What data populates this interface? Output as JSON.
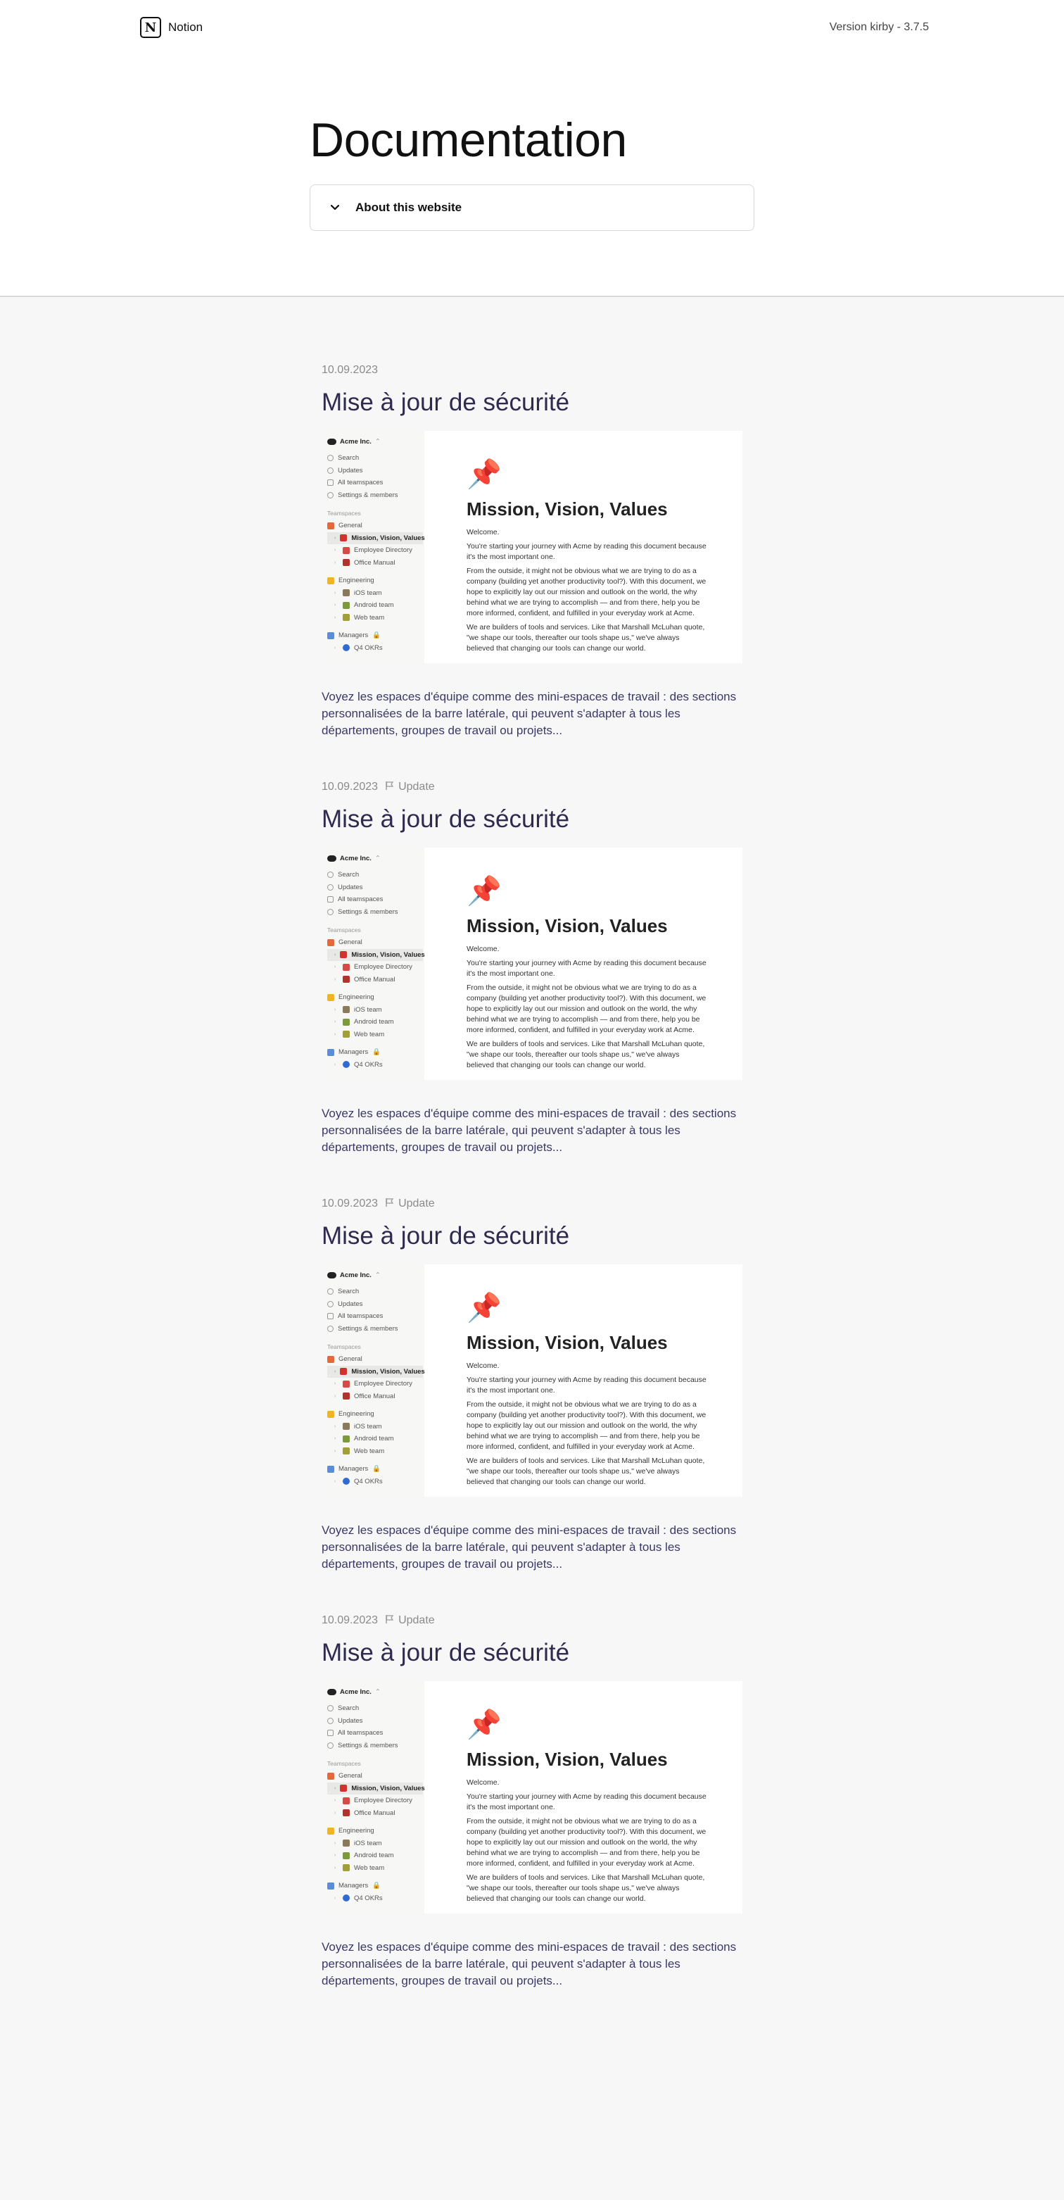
{
  "header": {
    "brand": "Notion",
    "version": "Version kirby - 3.7.5"
  },
  "page": {
    "title": "Documentation",
    "accordion_label": "About this website"
  },
  "screenshot": {
    "workspace": "Acme Inc.",
    "nav": [
      "Search",
      "Updates",
      "All teamspaces",
      "Settings & members"
    ],
    "section": "Teamspaces",
    "groups": [
      {
        "name": "General",
        "items": [
          "Mission, Vision, Values",
          "Employee Directory",
          "Office Manual"
        ]
      },
      {
        "name": "Engineering",
        "items": [
          "iOS team",
          "Android team",
          "Web team"
        ]
      },
      {
        "name": "Managers",
        "items": [
          "Q4 OKRs"
        ]
      }
    ],
    "doc_title": "Mission, Vision, Values",
    "doc_welcome": "Welcome.",
    "doc_p1": "You're starting your journey with Acme by reading this document because it's the most important one.",
    "doc_p2": "From the outside, it might not be obvious what we are trying to do as a company (building yet another productivity tool?). With this document, we hope to explicitly lay out our mission and outlook on the world, the why behind what we are trying to accomplish — and from there, help you be more informed, confident, and fulfilled in your everyday work at Acme.",
    "doc_p3": "We are builders of tools and services. Like that Marshall McLuhan quote, \"we shape our tools, thereafter our tools shape us,\" we've always believed that changing our tools can change our world."
  },
  "posts": [
    {
      "date": "10.09.2023",
      "tag": "",
      "title": "Mise à jour de sécurité",
      "excerpt": "Voyez les espaces d'équipe comme des mini-espaces de travail : des sections personnalisées de la barre latérale, qui peuvent s'adapter à tous les départements, groupes de travail ou projets..."
    },
    {
      "date": "10.09.2023",
      "tag": "Update",
      "title": "Mise à jour de sécurité",
      "excerpt": "Voyez les espaces d'équipe comme des mini-espaces de travail : des sections personnalisées de la barre latérale, qui peuvent s'adapter à tous les départements, groupes de travail ou projets..."
    },
    {
      "date": "10.09.2023",
      "tag": "Update",
      "title": "Mise à jour de sécurité",
      "excerpt": "Voyez les espaces d'équipe comme des mini-espaces de travail : des sections personnalisées de la barre latérale, qui peuvent s'adapter à tous les départements, groupes de travail ou projets..."
    },
    {
      "date": "10.09.2023",
      "tag": "Update",
      "title": "Mise à jour de sécurité",
      "excerpt": "Voyez les espaces d'équipe comme des mini-espaces de travail : des sections personnalisées de la barre latérale, qui peuvent s'adapter à tous les départements, groupes de travail ou projets..."
    }
  ]
}
